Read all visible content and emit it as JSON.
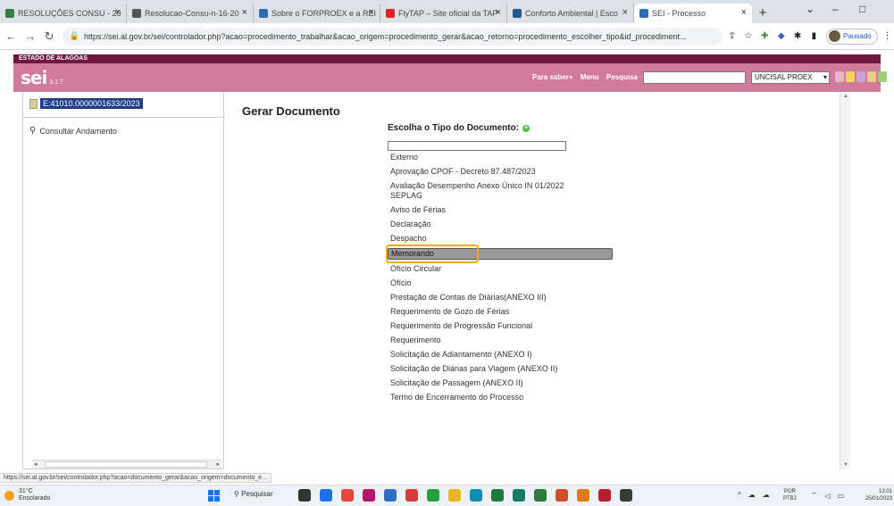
{
  "browser": {
    "tabs": [
      {
        "label": "RESOLUÇÕES CONSU - 20",
        "color": "#3a7d44"
      },
      {
        "label": "Resolucao-Consu-n-16-20",
        "color": "#555555"
      },
      {
        "label": "Sobre o FORPROEX e a REI",
        "color": "#2b6cb0"
      },
      {
        "label": "FlyTAP – Site oficial da TAP",
        "color": "#e02424"
      },
      {
        "label": "Conforto Ambiental | Esco",
        "color": "#1d5b8f"
      },
      {
        "label": "SEI - Processo",
        "color": "#2a6fb0"
      }
    ],
    "new_tab": "+",
    "close_glyph": "×",
    "url": "https://sei.al.gov.br/sei/controlador.php?acao=procedimento_trabalhar&acao_origem=procedimento_gerar&acao_retorno=procedimento_escolher_tipo&id_procediment...",
    "profile_label": "Pausado"
  },
  "sei": {
    "state_label": "ESTADO DE ALAGOAS",
    "logo": "sei",
    "version": "3.1.7",
    "menu": [
      "Para saber+",
      "Menu",
      "Pesquisa"
    ],
    "unit": "UNCISAL PROEX",
    "process_number": "E:41010.0000001633/2023",
    "consultar": "Consultar Andamento"
  },
  "main": {
    "title": "Gerar Documento",
    "choose_label": "Escolha o Tipo do Documento:",
    "plus_icon": "+",
    "doc_types": [
      "Externo",
      "Aprovação CPOF - Decreto 87.487/2023",
      "Avaliação Desempenho Anexo Único IN 01/2022 SEPLAG",
      "Aviso de Férias",
      "Declaração",
      "Despacho",
      "Memorando",
      "Ofício Circular",
      "Ofício",
      "Prestação de Contas de Diárias(ANEXO III)",
      "Requerimento de Gozo de Férias",
      "Requerimento de Progressão Funcional",
      "Requerimento",
      "Solicitação de Adiantamento (ANEXO I)",
      "Solicitação de Diárias para Viagem (ANEXO II)",
      "Solicitação de Passagem (ANEXO II)",
      "Termo de Encerramento do Processo"
    ],
    "selected_index": 6
  },
  "status_url": "https://sei.al.gov.br/sei/controlador.php?acao=documento_gerar&acao_origem=documento_e...",
  "taskbar": {
    "temp": "31°C",
    "weather": "Ensolarado",
    "search": "Pesquisar",
    "lang_1": "POR",
    "lang_2": "PTB2",
    "time": "13:01",
    "date": "25/01/2023"
  },
  "colors": {
    "sei_header": "#d27a9c",
    "sei_top": "#6e1740",
    "highlight": "#f2a900",
    "process_bg": "#1f3d8c"
  }
}
